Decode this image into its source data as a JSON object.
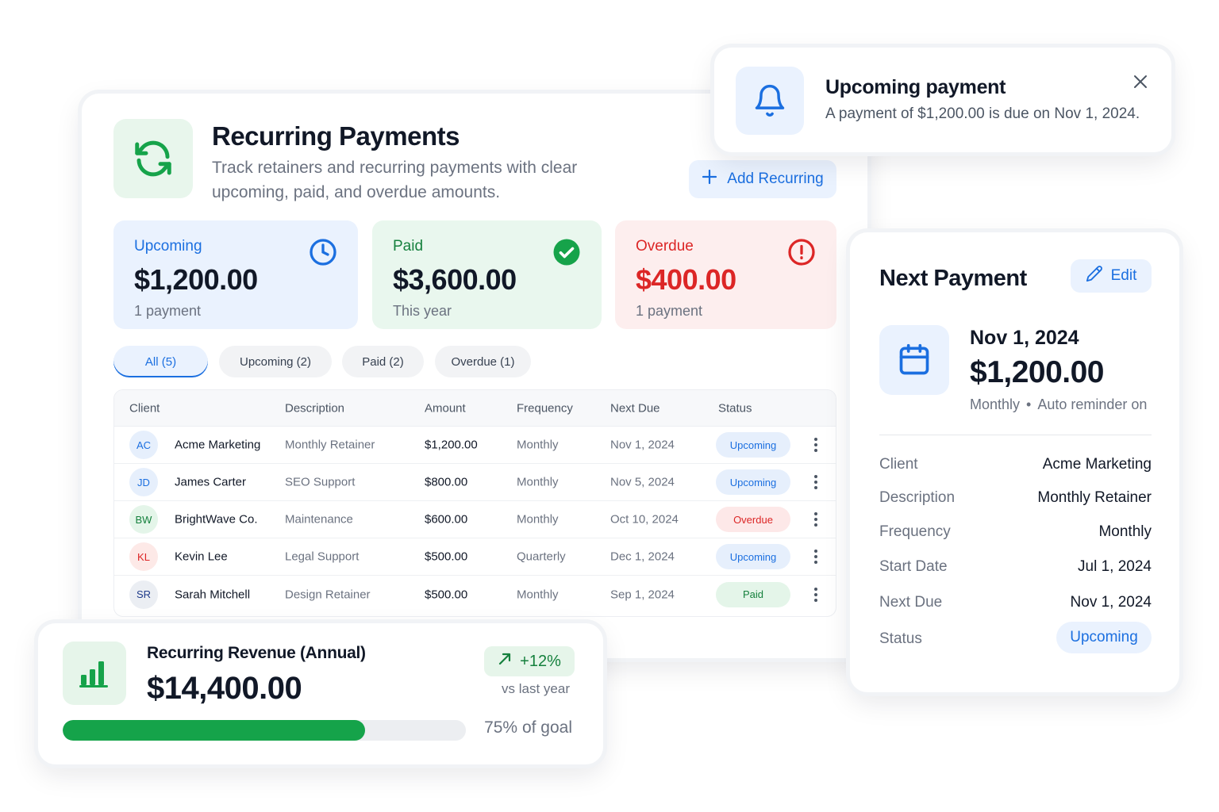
{
  "main": {
    "title": "Recurring Payments",
    "subtitle": "Track retainers and recurring payments with clear upcoming, paid, and overdue amounts.",
    "icon": "refresh-icon",
    "add_button": "Add Recurring",
    "stats": {
      "upcoming": {
        "label": "Upcoming",
        "value": "$1,200.00",
        "sub": "1 payment",
        "icon": "clock-icon"
      },
      "paid": {
        "label": "Paid",
        "value": "$3,600.00",
        "sub": "This year",
        "icon": "check-circle-icon"
      },
      "overdue": {
        "label": "Overdue",
        "value": "$400.00",
        "sub": "1 payment",
        "icon": "alert-circle-icon"
      }
    },
    "tabs": [
      "All (5)",
      "Upcoming (2)",
      "Paid (2)",
      "Overdue (1)"
    ],
    "active_tab": "All (5)",
    "table": {
      "columns": [
        "Client",
        "Description",
        "Amount",
        "Frequency",
        "Next Due",
        "Status"
      ],
      "rows": [
        {
          "initials": "AC",
          "client": "Acme Marketing",
          "description": "Monthly Retainer",
          "amount": "$1,200.00",
          "frequency": "Monthly",
          "next_due": "Nov 1, 2024",
          "status": "Upcoming"
        },
        {
          "initials": "JD",
          "client": "James Carter",
          "description": "SEO Support",
          "amount": "$800.00",
          "frequency": "Monthly",
          "next_due": "Nov 5, 2024",
          "status": "Upcoming"
        },
        {
          "initials": "BW",
          "client": "BrightWave Co.",
          "description": "Maintenance",
          "amount": "$600.00",
          "frequency": "Monthly",
          "next_due": "Oct 10, 2024",
          "status": "Overdue"
        },
        {
          "initials": "KL",
          "client": "Kevin Lee",
          "description": "Legal Support",
          "amount": "$500.00",
          "frequency": "Quarterly",
          "next_due": "Dec 1, 2024",
          "status": "Upcoming"
        },
        {
          "initials": "SR",
          "client": "Sarah Mitchell",
          "description": "Design Retainer",
          "amount": "$500.00",
          "frequency": "Monthly",
          "next_due": "Sep 1, 2024",
          "status": "Paid"
        }
      ]
    }
  },
  "toast": {
    "title": "Upcoming payment",
    "message": "A payment of $1,200.00 is due on Nov 1, 2024.",
    "icon": "bell-icon"
  },
  "next_payment": {
    "title": "Next Payment",
    "edit_label": "Edit",
    "date": "Nov 1, 2024",
    "amount": "$1,200.00",
    "frequency": "Monthly",
    "reminder": "Auto reminder on",
    "details": [
      {
        "key": "Client",
        "value": "Acme Marketing"
      },
      {
        "key": "Description",
        "value": "Monthly Retainer"
      },
      {
        "key": "Frequency",
        "value": "Monthly"
      },
      {
        "key": "Start Date",
        "value": "Jul 1, 2024"
      },
      {
        "key": "Next Due",
        "value": "Nov 1, 2024"
      }
    ],
    "status_label": "Status",
    "status_value": "Upcoming"
  },
  "revenue": {
    "title": "Recurring Revenue (Annual)",
    "value": "$14,400.00",
    "change": "+12%",
    "comparison": "vs last year",
    "progress_fraction": 0.75,
    "goal_text": "75% of goal"
  },
  "colors": {
    "accent_blue": "#1b6fe0",
    "success_green": "#15803d",
    "danger_red": "#dc2626"
  }
}
